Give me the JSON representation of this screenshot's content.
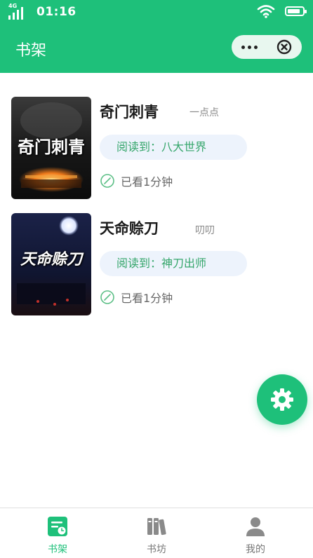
{
  "status_bar": {
    "network": "4G",
    "time": "01:16",
    "battery_level": 0.85
  },
  "header": {
    "title": "书架"
  },
  "books": [
    {
      "cover_title": "奇门刺青",
      "name": "奇门刺青",
      "author": "一点点",
      "progress": "阅读到：八大世界",
      "read_time": "已看1分钟"
    },
    {
      "cover_title": "天命赊刀",
      "name": "天命赊刀",
      "author": "叨叨",
      "progress": "阅读到：神刀出师",
      "read_time": "已看1分钟"
    }
  ],
  "tabs": [
    {
      "label": "书架",
      "icon": "bookshelf-icon",
      "active": true
    },
    {
      "label": "书坊",
      "icon": "books-icon",
      "active": false
    },
    {
      "label": "我的",
      "icon": "user-icon",
      "active": false
    }
  ],
  "colors": {
    "brand": "#1ec07a",
    "progress_text": "#35a66b",
    "progress_bg": "#edf3fc"
  }
}
